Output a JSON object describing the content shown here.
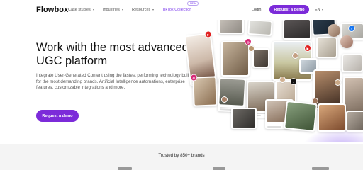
{
  "nav": {
    "logo": "Flowbox",
    "links": [
      {
        "label": "Case studies",
        "has_dropdown": true
      },
      {
        "label": "Industries",
        "has_dropdown": true
      },
      {
        "label": "Resources",
        "has_dropdown": true
      },
      {
        "label": "TikTok Collection",
        "has_dropdown": false
      }
    ],
    "new_badge": "NEW",
    "login": "Login",
    "cta": "Request a demo",
    "language": "EN"
  },
  "hero": {
    "title": "Work with the most advanced UGC platform",
    "description": "Integrate User-Generated Content using the fastest performing technology built for the most demanding brands. Artificial Intelligence automations, enterprise features, customizable integrations and more.",
    "cta": "Request a demo"
  },
  "footer": {
    "trusted_text": "Trusted by 850+ brands"
  },
  "collage": {
    "platform_icons": [
      "youtube-icon",
      "instagram-icon",
      "facebook-icon",
      "tiktok-icon"
    ]
  },
  "colors": {
    "brand_purple": "#7c2bd9",
    "text_dark": "#111111",
    "text_muted": "#555555",
    "footer_bg": "#f4f4f4"
  }
}
